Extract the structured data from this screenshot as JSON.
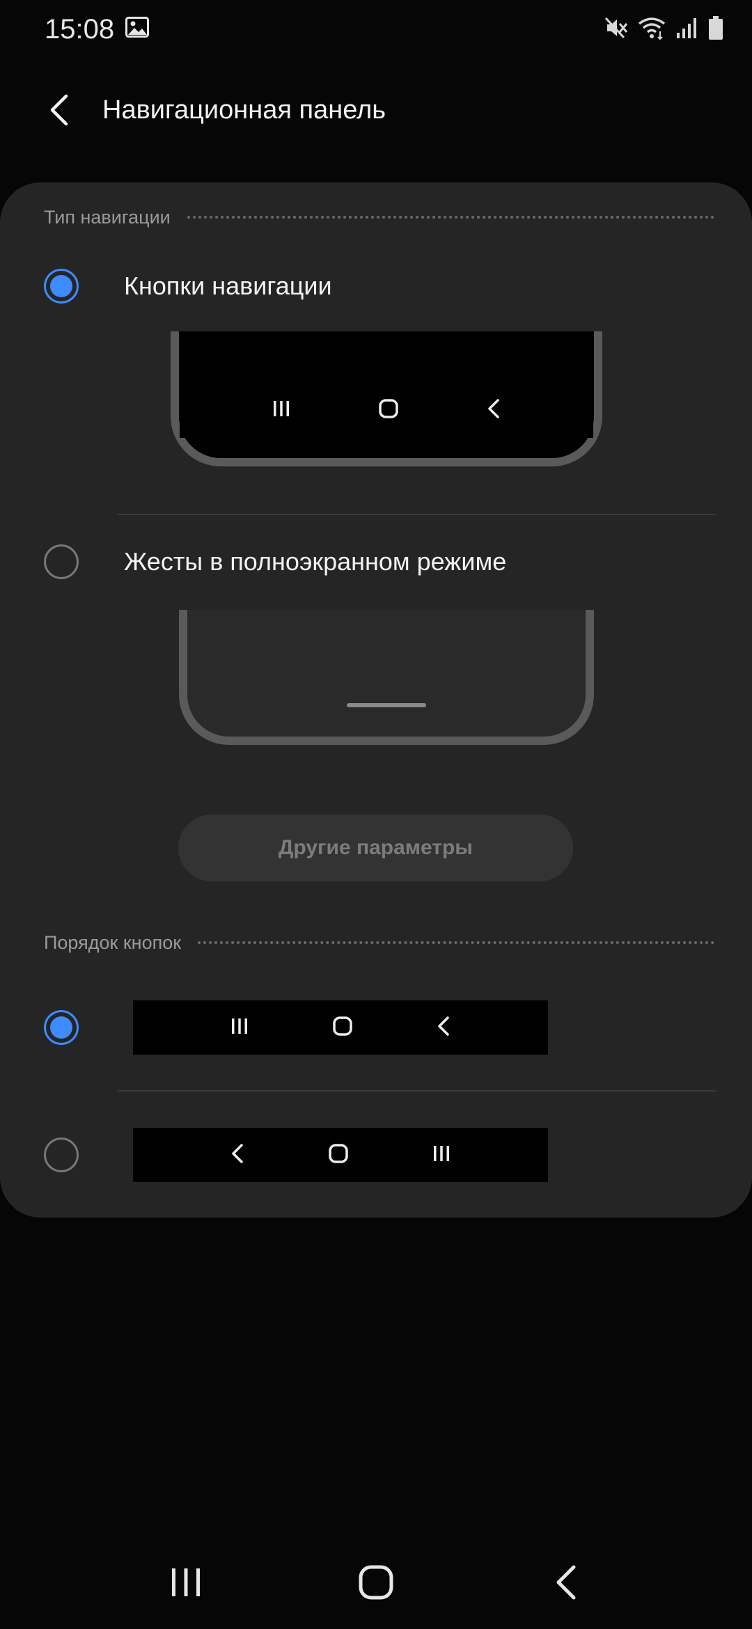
{
  "status_bar": {
    "time": "15:08",
    "icons": [
      "gallery-icon",
      "mute-icon",
      "wifi-icon",
      "signal-icon",
      "battery-icon"
    ]
  },
  "header": {
    "title": "Навигационная панель",
    "back_icon": "chevron-left-icon"
  },
  "navigation_type": {
    "section_label": "Тип навигации",
    "options": [
      {
        "label": "Кнопки навигации",
        "selected": true
      },
      {
        "label": "Жесты в полноэкранном режиме",
        "selected": false
      }
    ]
  },
  "other_settings_button": {
    "label": "Другие параметры",
    "enabled": false
  },
  "button_order": {
    "section_label": "Порядок кнопок",
    "options": [
      {
        "order": [
          "recents-icon",
          "home-icon",
          "back-icon"
        ],
        "selected": true
      },
      {
        "order": [
          "back-icon",
          "home-icon",
          "recents-icon"
        ],
        "selected": false
      }
    ]
  },
  "colors": {
    "accent": "#3e8bff",
    "card_background": "#252525",
    "screen_background": "#060606"
  }
}
